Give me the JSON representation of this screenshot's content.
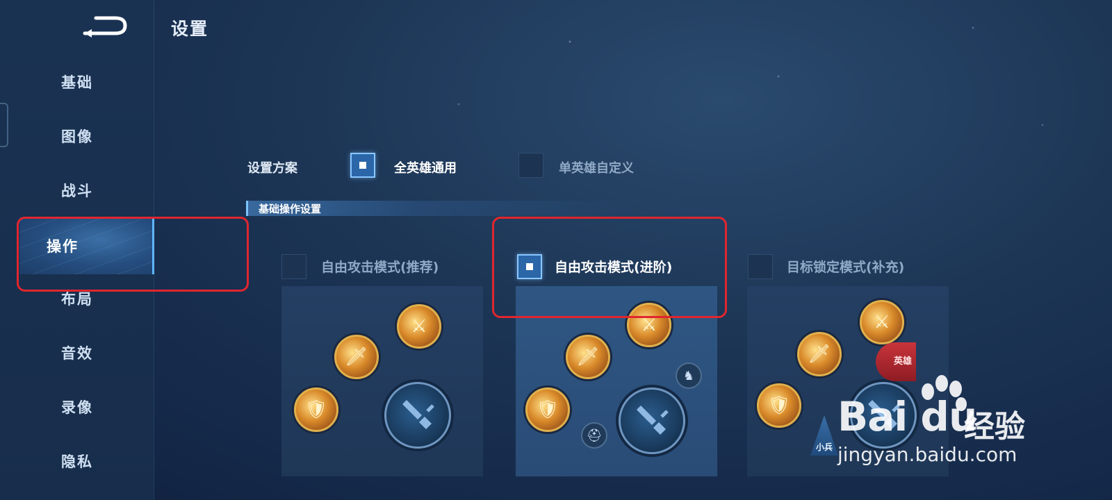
{
  "header": {
    "title": "设置"
  },
  "sidebar": {
    "items": [
      {
        "label": "基础"
      },
      {
        "label": "图像"
      },
      {
        "label": "战斗"
      },
      {
        "label": "操作",
        "active": true
      },
      {
        "label": "布局"
      },
      {
        "label": "音效"
      },
      {
        "label": "录像"
      },
      {
        "label": "隐私"
      }
    ]
  },
  "scheme": {
    "label": "设置方案",
    "options": [
      {
        "label": "全英雄通用",
        "checked": true
      },
      {
        "label": "单英雄自定义",
        "checked": false
      }
    ]
  },
  "section": {
    "title": "基础操作设置"
  },
  "modes": [
    {
      "label": "自由攻击模式(推荐)",
      "checked": false
    },
    {
      "label": "自由攻击模式(进阶)",
      "checked": true
    },
    {
      "label": "目标锁定模式(补充)",
      "checked": false
    }
  ],
  "tags": {
    "hero": "英雄",
    "minion": "小兵"
  },
  "watermark": {
    "brand": "Bai du",
    "cn": "经验",
    "url": "jingyan.baidu.com"
  },
  "colors": {
    "accent": "#8bc7ff",
    "annotation": "#e0262e",
    "active_bg": "#2b66a8"
  }
}
